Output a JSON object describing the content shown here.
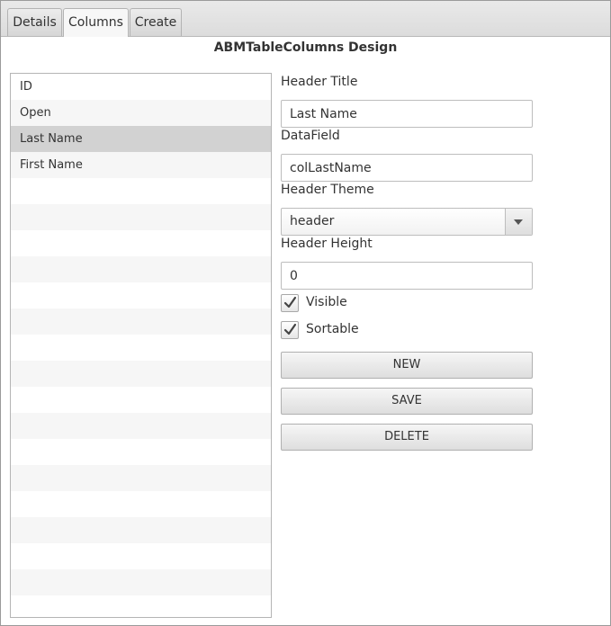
{
  "tabs": [
    {
      "label": "Details"
    },
    {
      "label": "Columns",
      "active": true
    },
    {
      "label": "Create"
    }
  ],
  "page_title": "ABMTableColumns Design",
  "columns_list": {
    "items": [
      "ID",
      "Open",
      "Last Name",
      "First Name"
    ],
    "selected": "Last Name"
  },
  "form": {
    "header_title": {
      "label": "Header Title",
      "value": "Last Name"
    },
    "data_field": {
      "label": "DataField",
      "value": "colLastName"
    },
    "header_theme": {
      "label": "Header Theme",
      "value": "header"
    },
    "header_height": {
      "label": "Header Height",
      "value": "0"
    },
    "visible": {
      "label": "Visible",
      "checked": true
    },
    "sortable": {
      "label": "Sortable",
      "checked": true
    }
  },
  "buttons": {
    "new": "NEW",
    "save": "SAVE",
    "delete": "DELETE"
  },
  "icons": {
    "combo_arrow": "chevron-down-icon",
    "checkmark": "checkmark-icon"
  }
}
